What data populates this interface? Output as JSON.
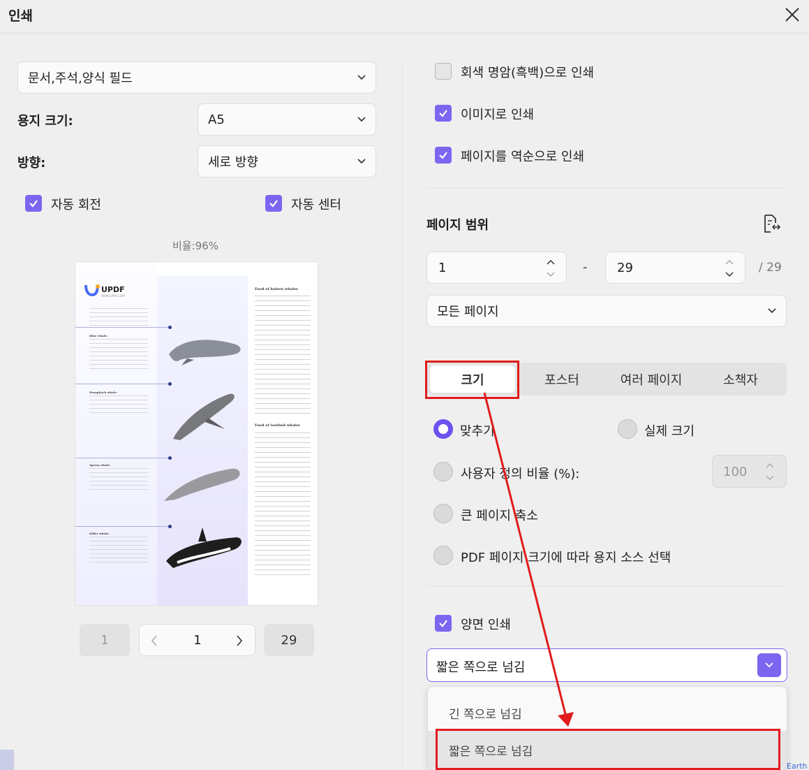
{
  "dialog": {
    "title": "인쇄"
  },
  "left": {
    "content_select": "문서,주석,양식 필드",
    "paper_size_label": "용지 크기:",
    "paper_size_value": "A5",
    "orientation_label": "방향:",
    "orientation_value": "세로 방향",
    "auto_rotate": {
      "label": "자동 회전",
      "checked": true
    },
    "auto_center": {
      "label": "자동 센터",
      "checked": true
    },
    "scale_text": "비율:96%",
    "pager": {
      "first": "1",
      "current": "1",
      "last": "29"
    }
  },
  "preview_doc": {
    "logo_text": "UPDF",
    "logo_sub": "WWW.UPDF.COM",
    "heading1": "Food of baleen whales",
    "heading2": "Food of toothed whales",
    "blue_whale": "Blue whale:",
    "humpback": "Humpback whale:",
    "sperm": "Sperm whale:",
    "killer": "Killer whale:"
  },
  "right": {
    "grayscale": {
      "label": "회색 명암(흑백)으로 인쇄",
      "checked": false
    },
    "as_image": {
      "label": "이미지로 인쇄",
      "checked": true
    },
    "reverse": {
      "label": "페이지를 역순으로 인쇄",
      "checked": true
    },
    "page_range_title": "페이지 범위",
    "range_from": "1",
    "range_sep": "-",
    "range_to": "29",
    "range_total": "/ 29",
    "pages_select": "모든 페이지",
    "tabs": [
      "크기",
      "포스터",
      "여러 페이지",
      "소책자"
    ],
    "active_tab": "크기",
    "fit": {
      "label": "맞추기",
      "selected": true
    },
    "actual_size": {
      "label": "실제 크기",
      "selected": false
    },
    "custom_scale": {
      "label": "사용자 정의 비율 (%):",
      "selected": false,
      "value": "100"
    },
    "shrink_large": {
      "label": "큰 페이지 축소",
      "selected": false
    },
    "pdf_paper_source": {
      "label": "PDF 페이지 크기에 따라 용지 소스 선택",
      "selected": false
    },
    "duplex": {
      "label": "양면 인쇄",
      "checked": true
    },
    "flip_select": "짧은 쪽으로 넘김",
    "flip_options": [
      "긴 쪽으로 넘김",
      "짧은 쪽으로 넘김"
    ]
  },
  "background_fragment": "Earth",
  "colors": {
    "accent": "#7b66f0",
    "annotation": "#e21b1b"
  }
}
